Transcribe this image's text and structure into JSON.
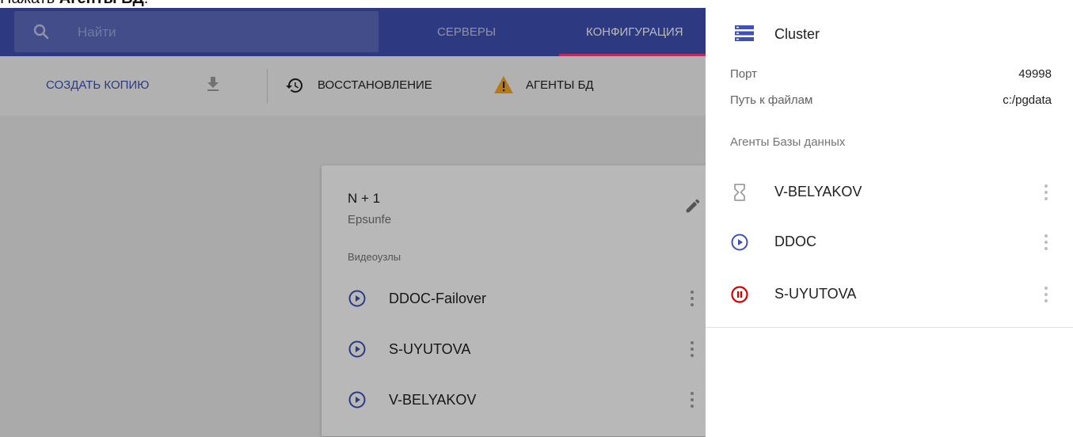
{
  "caption": {
    "prefix": "Нажать ",
    "bold": "Агенты БД",
    "suffix": "."
  },
  "colors": {
    "primary": "#3f51b5",
    "accent": "#ff4081",
    "warning": "#f9a825",
    "error": "#d50000",
    "play": "#3f51b5"
  },
  "topbar": {
    "search_placeholder": "Найти",
    "tabs": [
      {
        "label": "СЕРВЕРЫ",
        "active": false
      },
      {
        "label": "КОНФИГУРАЦИЯ",
        "active": true
      }
    ]
  },
  "toolbar": {
    "create_copy": "СОЗДАТЬ КОПИЮ",
    "download_icon": "download-icon",
    "restore": "ВОССТАНОВЛЕНИЕ",
    "restore_icon": "history-icon",
    "agents": "АГЕНТЫ БД",
    "agents_icon": "warning-icon"
  },
  "card": {
    "title": "N + 1",
    "subtitle": "Epsunfe",
    "section_label": "Видеоузлы",
    "nodes": [
      {
        "label": "DDOC-Failover",
        "icon": "play-circle-icon"
      },
      {
        "label": "S-UYUTOVA",
        "icon": "play-circle-icon"
      },
      {
        "label": "V-BELYAKOV",
        "icon": "play-circle-icon"
      }
    ]
  },
  "panel": {
    "title": "Cluster",
    "icon": "storage-icon",
    "properties": [
      {
        "label": "Порт",
        "value": "49998"
      },
      {
        "label": "Путь к файлам",
        "value": "c:/pgdata"
      }
    ],
    "section_label": "Агенты Базы данных",
    "agents": [
      {
        "label": "V-BELYAKOV",
        "icon": "hourglass-icon",
        "status": "pending"
      },
      {
        "label": "DDOC",
        "icon": "play-circle-icon",
        "status": "running"
      },
      {
        "label": "S-UYUTOVA",
        "icon": "pause-circle-icon",
        "status": "paused"
      }
    ]
  }
}
